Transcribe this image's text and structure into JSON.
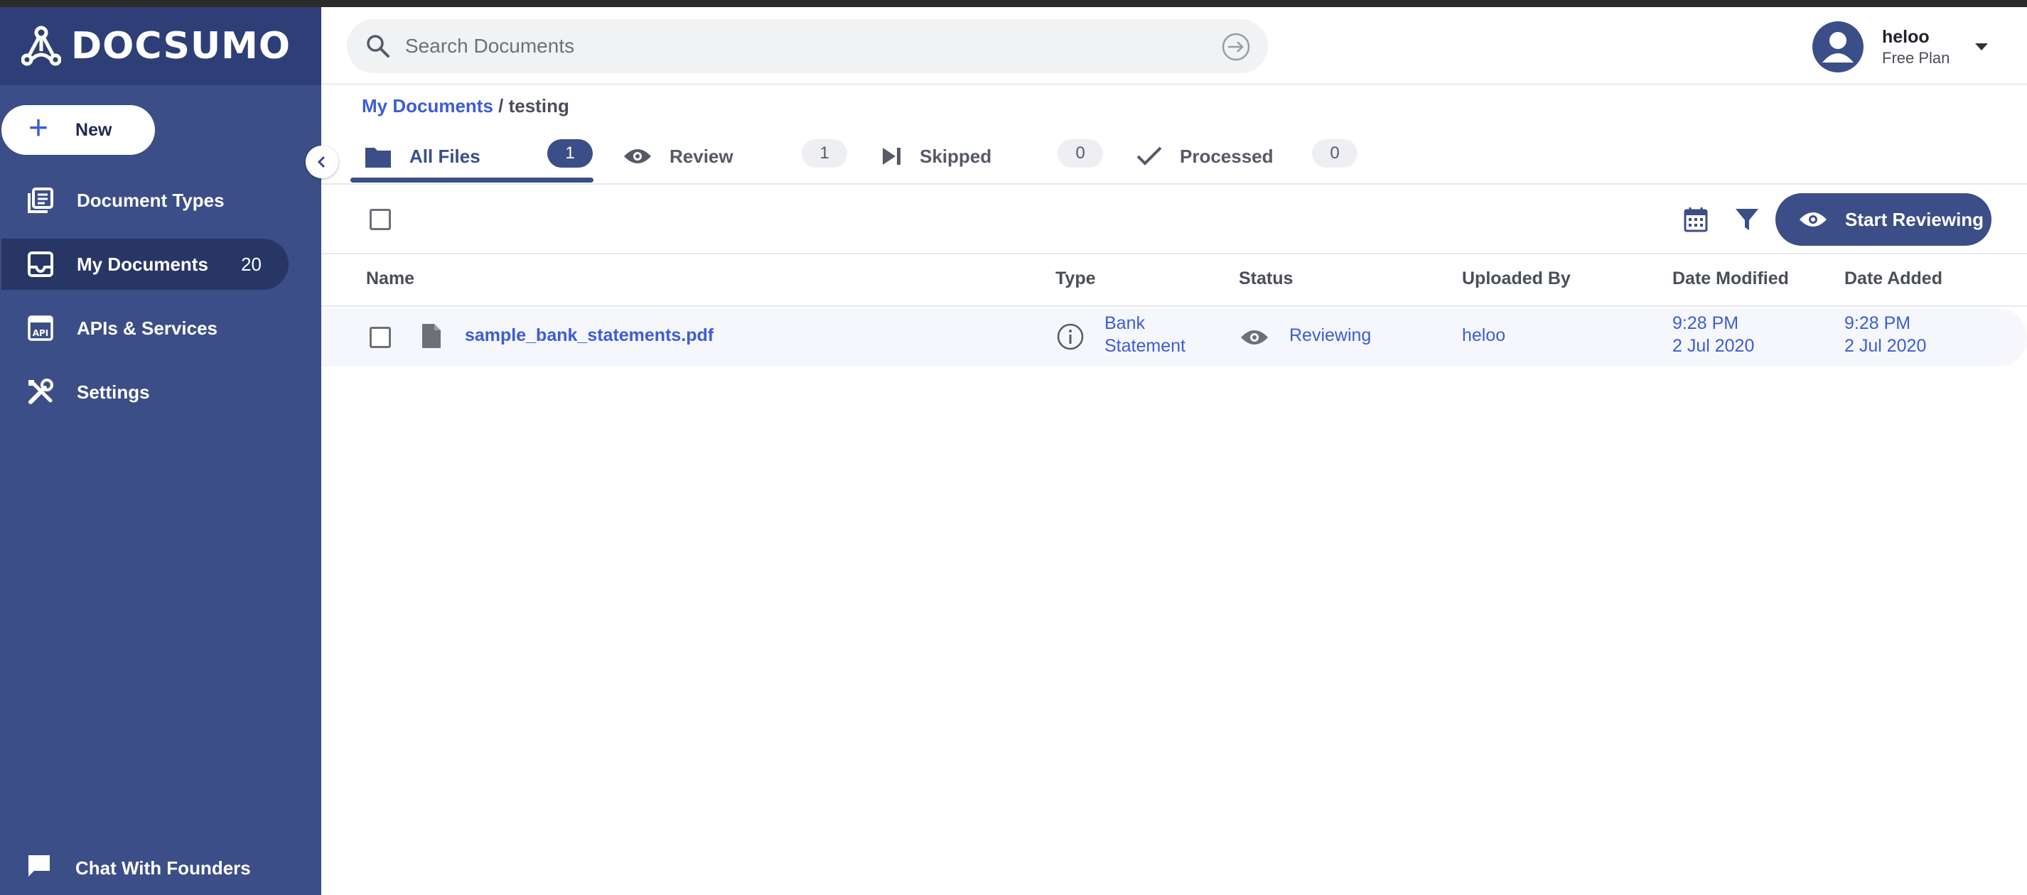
{
  "brand": {
    "logo_text": "DOCSUMO"
  },
  "sidebar": {
    "new_label": "New",
    "items": [
      {
        "label": "Document Types",
        "icon": "document-types-icon"
      },
      {
        "label": "My Documents",
        "icon": "inbox-icon",
        "count": "20"
      },
      {
        "label": "APIs & Services",
        "icon": "api-icon"
      },
      {
        "label": "Settings",
        "icon": "tools-icon"
      }
    ],
    "chat_label": "Chat With Founders"
  },
  "header": {
    "search_placeholder": "Search Documents",
    "user_name": "heloo",
    "user_plan": "Free Plan"
  },
  "breadcrumb": {
    "root": "My Documents",
    "current": "/ testing"
  },
  "tabs": [
    {
      "label": "All Files",
      "count": "1",
      "icon": "folder-icon"
    },
    {
      "label": "Review",
      "count": "1",
      "icon": "eye-icon"
    },
    {
      "label": "Skipped",
      "count": "0",
      "icon": "skip-icon"
    },
    {
      "label": "Processed",
      "count": "0",
      "icon": "check-icon"
    }
  ],
  "toolbar": {
    "start_reviewing_label": "Start Reviewing"
  },
  "table": {
    "columns": [
      "Name",
      "Type",
      "Status",
      "Uploaded By",
      "Date Modified",
      "Date Added"
    ],
    "rows": [
      {
        "name": "sample_bank_statements.pdf",
        "type_line1": "Bank",
        "type_line2": "Statement",
        "status": "Reviewing",
        "uploaded_by": "heloo",
        "modified_time": "9:28 PM",
        "modified_date": "2 Jul 2020",
        "added_time": "9:28 PM",
        "added_date": "2 Jul 2020"
      }
    ]
  },
  "colors": {
    "sidebar": "#3c4e87",
    "accent": "#3d5bd9",
    "active_nav": "#283666"
  }
}
